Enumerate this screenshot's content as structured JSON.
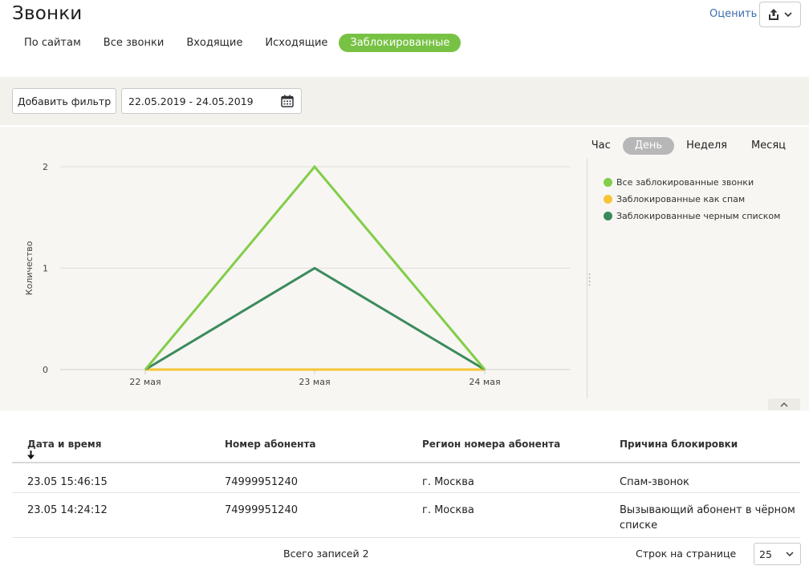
{
  "header": {
    "title": "Звонки",
    "rate_label": "Оценить"
  },
  "tabs": [
    {
      "label": "По сайтам",
      "active": false
    },
    {
      "label": "Все звонки",
      "active": false
    },
    {
      "label": "Входящие",
      "active": false
    },
    {
      "label": "Исходящие",
      "active": false
    },
    {
      "label": "Заблокированные",
      "active": true
    }
  ],
  "filters": {
    "add_filter_label": "Добавить фильтр",
    "date_range": "22.05.2019 - 24.05.2019"
  },
  "period_switch": [
    {
      "label": "Час",
      "active": false
    },
    {
      "label": "День",
      "active": true
    },
    {
      "label": "Неделя",
      "active": false
    },
    {
      "label": "Месяц",
      "active": false
    }
  ],
  "chart_data": {
    "type": "line",
    "categories": [
      "22 мая",
      "23 мая",
      "24 мая"
    ],
    "ylabel": "Количество",
    "xlabel": "",
    "ylim": [
      0,
      2
    ],
    "yticks": [
      0,
      1,
      2
    ],
    "grid": true,
    "legend_position": "right",
    "series": [
      {
        "name": "Все заблокированные звонки",
        "color": "#82cd49",
        "values": [
          0,
          2,
          0
        ]
      },
      {
        "name": "Заблокированные как спам",
        "color": "#f6c437",
        "values": [
          0,
          0,
          0
        ]
      },
      {
        "name": "Заблокированные черным списком",
        "color": "#3b8a5d",
        "values": [
          0,
          1,
          0
        ]
      }
    ]
  },
  "table": {
    "columns": [
      "Дата и время",
      "Номер абонента",
      "Регион номера абонента",
      "Причина блокировки"
    ],
    "rows": [
      {
        "datetime": "23.05 15:46:15",
        "number": "74999951240",
        "region": "г. Москва",
        "reason": "Спам-звонок"
      },
      {
        "datetime": "23.05 14:24:12",
        "number": "74999951240",
        "region": "г. Москва",
        "reason": "Вызывающий абонент в чёрном списке"
      }
    ]
  },
  "footer": {
    "total_label": "Всего записей 2",
    "rows_per_page_label": "Строк на странице",
    "rows_per_page_value": "25"
  },
  "icons": {
    "export": "share-upload-icon",
    "calendar": "calendar-icon",
    "sort": "arrow-down-icon",
    "collapse": "chevron-up-icon",
    "select": "chevron-down-icon"
  }
}
